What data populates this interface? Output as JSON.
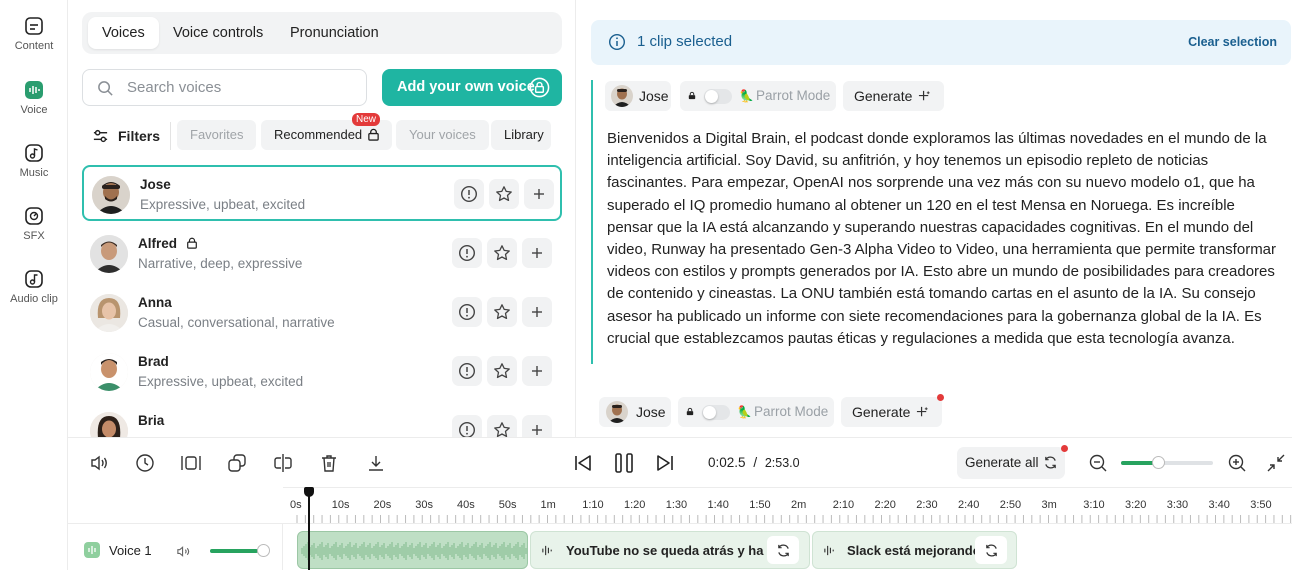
{
  "rail": [
    {
      "label": "Content",
      "icon": "content-icon"
    },
    {
      "label": "Voice",
      "icon": "voice-icon"
    },
    {
      "label": "Music",
      "icon": "music-icon"
    },
    {
      "label": "SFX",
      "icon": "sfx-icon"
    },
    {
      "label": "Audio clip",
      "icon": "audio-clip-icon"
    }
  ],
  "tabs": [
    "Voices",
    "Voice controls",
    "Pronunciation"
  ],
  "search": {
    "placeholder": "Search voices"
  },
  "add_voice": "Add your own voice",
  "filters": {
    "label": "Filters",
    "chips": [
      "Favorites",
      "Recommended",
      "Your voices",
      "Library"
    ],
    "new_badge": "New"
  },
  "voices": [
    {
      "name": "Jose",
      "desc": "Expressive, upbeat, excited"
    },
    {
      "name": "Alfred",
      "desc": "Narrative, deep, expressive"
    },
    {
      "name": "Anna",
      "desc": "Casual, conversational, narrative"
    },
    {
      "name": "Brad",
      "desc": "Expressive, upbeat, excited"
    },
    {
      "name": "Bria",
      "desc": ""
    }
  ],
  "selection": {
    "text": "1 clip selected",
    "clear": "Clear selection"
  },
  "block1": {
    "speaker": "Jose",
    "mode": "Parrot Mode",
    "generate": "Generate",
    "text": "Bienvenidos a Digital Brain, el podcast donde exploramos las últimas novedades en el mundo de la inteligencia artificial. Soy David, su anfitrión, y hoy tenemos un episodio repleto de noticias fascinantes. Para empezar, OpenAI nos sorprende una vez más con su nuevo modelo o1, que ha superado el IQ promedio humano al obtener un 120 en el test Mensa en Noruega. Es increíble pensar que la IA está alcanzando y superando nuestras capacidades cognitivas. En el mundo del video, Runway ha presentado Gen-3 Alpha Video to Video, una herramienta que permite transformar videos con estilos y prompts generados por IA. Esto abre un mundo de posibilidades para creadores de contenido y cineastas. La ONU también está tomando cartas en el asunto de la IA. Su consejo asesor ha publicado un informe con siete recomendaciones para la gobernanza global de la IA. Es crucial que establezcamos pautas éticas y regulaciones a medida que esta tecnología avanza."
  },
  "block2": {
    "speaker": "Jose",
    "mode": "Parrot Mode",
    "generate": "Generate"
  },
  "player": {
    "current": "0:02.5",
    "separator": "/",
    "total": "2:53.0",
    "generate_all": "Generate all"
  },
  "ruler": [
    "0s",
    "10s",
    "20s",
    "30s",
    "40s",
    "50s",
    "1m",
    "1:10",
    "1:20",
    "1:30",
    "1:40",
    "1:50",
    "2m",
    "2:10",
    "2:20",
    "2:30",
    "2:40",
    "2:50",
    "3m",
    "3:10",
    "3:20",
    "3:30",
    "3:40",
    "3:50"
  ],
  "track": {
    "name": "Voice 1",
    "volume": 0.85,
    "clips": [
      {
        "label": ""
      },
      {
        "label": "YouTube no se queda atrás y ha est"
      },
      {
        "label": "Slack está mejorando"
      }
    ]
  },
  "colors": {
    "accent": "#1fb5a2",
    "badge": "#e33a3a",
    "banner": "#e9f4fb",
    "clip": "#e8f3ea"
  }
}
